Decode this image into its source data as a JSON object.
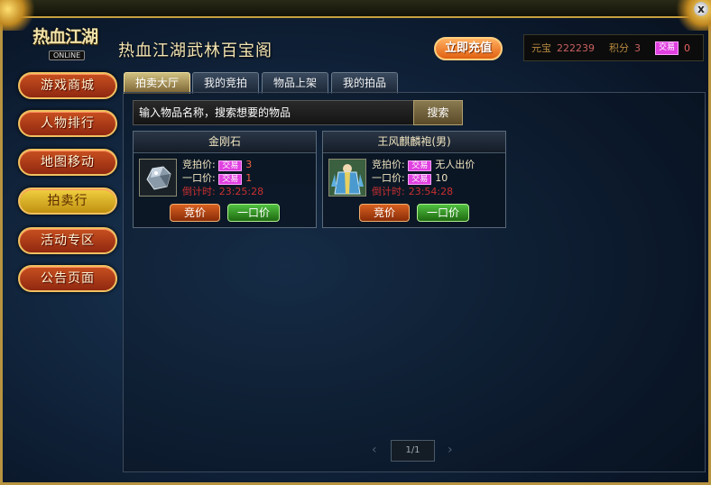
{
  "window": {
    "close_label": "x"
  },
  "logo": {
    "text": "热血江湖",
    "sub": "ONLINE"
  },
  "title": "热血江湖武林百宝阁",
  "recharge_label": "立即充值",
  "stats": {
    "yuanbao_label": "元宝",
    "yuanbao_value": "222239",
    "points_label": "积分",
    "points_value": "3",
    "trade_badge": "交易",
    "trade_value": "0"
  },
  "sidebar": {
    "items": [
      {
        "label": "游戏商城"
      },
      {
        "label": "人物排行"
      },
      {
        "label": "地图移动"
      },
      {
        "label": "拍卖行"
      },
      {
        "label": "活动专区"
      },
      {
        "label": "公告页面"
      }
    ]
  },
  "tabs": [
    {
      "label": "拍卖大厅"
    },
    {
      "label": "我的竞拍"
    },
    {
      "label": "物品上架"
    },
    {
      "label": "我的拍品"
    }
  ],
  "search": {
    "placeholder": "输入物品名称，搜索想要的物品",
    "button_label": "搜索"
  },
  "items": [
    {
      "name": "金刚石",
      "bid_label": "竞拍价:",
      "bid_badge": "交易",
      "bid_value": "3",
      "buy_label": "一口价:",
      "buy_badge": "交易",
      "buy_value": "1",
      "countdown_label": "倒计时:",
      "countdown_value": "23:25:28",
      "bid_button": "竞价",
      "buy_button": "一口价"
    },
    {
      "name": "王风麒麟袍(男)",
      "bid_label": "竞拍价:",
      "bid_badge": "交易",
      "bid_value": "无人出价",
      "buy_label": "一口价:",
      "buy_badge": "交易",
      "buy_value": "10",
      "countdown_label": "倒计时:",
      "countdown_value": "23:54:28",
      "bid_button": "竞价",
      "buy_button": "一口价"
    }
  ],
  "pager": {
    "text": "1/1",
    "prev_icon": "‹",
    "next_icon": "›"
  }
}
